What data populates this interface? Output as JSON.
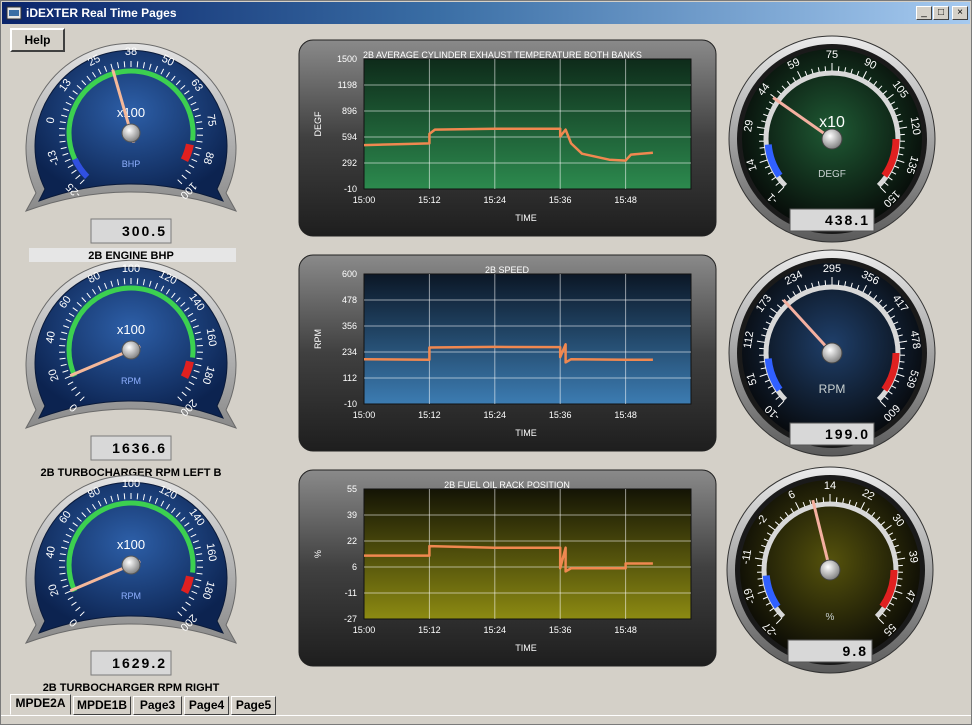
{
  "window": {
    "title": "iDEXTER Real Time Pages"
  },
  "window_controls": {
    "minimize": "_",
    "maximize": "□",
    "close": "×"
  },
  "help": {
    "label": "Help"
  },
  "tabs": [
    {
      "label": "MPDE2A",
      "active": true
    },
    {
      "label": "MPDE1B",
      "active": false
    },
    {
      "label": "Page3",
      "active": false
    },
    {
      "label": "Page4",
      "active": false
    },
    {
      "label": "Page5",
      "active": false
    }
  ],
  "left_gauges": [
    {
      "ticks": [
        "-25",
        "-13",
        "0",
        "13",
        "25",
        "38",
        "50",
        "63",
        "75",
        "88",
        "100"
      ],
      "min": -25,
      "max": 100,
      "value": 30.05,
      "multiplier": "x100",
      "unit": "BHP",
      "readout": "300.5",
      "caption": "2B ENGINE BHP",
      "caption_highlight": true
    },
    {
      "ticks": [
        "0",
        "20",
        "40",
        "60",
        "80",
        "100",
        "120",
        "140",
        "160",
        "180",
        "200"
      ],
      "min": 0,
      "max": 200,
      "value": 16.37,
      "multiplier": "x100",
      "unit": "RPM",
      "readout": "1636.6",
      "caption": "2B TURBOCHARGER RPM LEFT B",
      "caption_highlight": false
    },
    {
      "ticks": [
        "0",
        "20",
        "40",
        "60",
        "80",
        "100",
        "120",
        "140",
        "160",
        "180",
        "200"
      ],
      "min": 0,
      "max": 200,
      "value": 16.29,
      "multiplier": "x100",
      "unit": "RPM",
      "readout": "1629.2",
      "caption": "2B TURBOCHARGER RPM RIGHT",
      "caption_highlight": false
    }
  ],
  "right_gauges": [
    {
      "ticks": [
        "-1",
        "14",
        "29",
        "44",
        "59",
        "75",
        "90",
        "105",
        "120",
        "135",
        "150"
      ],
      "min": -1,
      "max": 150,
      "value": 43.8,
      "multiplier": "x10",
      "unit": "DEGF",
      "readout": "438.1",
      "face_color": "#1f5a34"
    },
    {
      "ticks": [
        "-10",
        "51",
        "112",
        "173",
        "234",
        "295",
        "356",
        "417",
        "478",
        "539",
        "600"
      ],
      "min": -10,
      "max": 600,
      "value": 199.0,
      "multiplier": "",
      "unit": "RPM",
      "readout": "199.0",
      "face_color": "#1f3f6a"
    },
    {
      "ticks": [
        "-27",
        "-19",
        "-11",
        "-2",
        "6",
        "14",
        "22",
        "30",
        "39",
        "47",
        "55"
      ],
      "min": -27,
      "max": 55,
      "value": 9.8,
      "multiplier": "",
      "unit": "%",
      "readout": "9.8",
      "face_color": "#55520c"
    }
  ],
  "chart_data": [
    {
      "type": "line",
      "title": "2B AVERAGE CYLINDER EXHAUST TEMPERATURE BOTH BANKS",
      "xlabel": "TIME",
      "ylabel": "DEGF",
      "x_ticks": [
        "15:00",
        "15:12",
        "15:24",
        "15:36",
        "15:48"
      ],
      "y_ticks": [
        "1500",
        "1198",
        "896",
        "594",
        "292",
        "-10"
      ],
      "ylim": [
        -10,
        1500
      ],
      "xlim": [
        "15:00",
        "16:00"
      ],
      "grid": true,
      "bg_top": "#0e2b1a",
      "bg_bottom": "#2c8a4e",
      "series": [
        {
          "color": "#f08850",
          "x": [
            "15:00",
            "15:06",
            "15:12",
            "15:12",
            "15:13",
            "15:24",
            "15:36",
            "15:36",
            "15:37",
            "15:38",
            "15:40",
            "15:45",
            "15:48",
            "15:49",
            "15:53"
          ],
          "y": [
            500,
            510,
            520,
            630,
            680,
            690,
            690,
            600,
            680,
            520,
            400,
            330,
            320,
            390,
            410
          ]
        }
      ]
    },
    {
      "type": "line",
      "title": "2B SPEED",
      "xlabel": "TIME",
      "ylabel": "RPM",
      "x_ticks": [
        "15:00",
        "15:12",
        "15:24",
        "15:36",
        "15:48"
      ],
      "y_ticks": [
        "600",
        "478",
        "356",
        "234",
        "112",
        "-10"
      ],
      "ylim": [
        -10,
        600
      ],
      "xlim": [
        "15:00",
        "16:00"
      ],
      "grid": true,
      "bg_top": "#0b1726",
      "bg_bottom": "#3c7cb2",
      "series": [
        {
          "color": "#f08850",
          "x": [
            "15:00",
            "15:12",
            "15:12",
            "15:24",
            "15:36",
            "15:36",
            "15:37",
            "15:37",
            "15:38",
            "15:48",
            "15:53"
          ],
          "y": [
            200,
            198,
            255,
            258,
            257,
            210,
            270,
            185,
            200,
            198,
            198
          ]
        }
      ]
    },
    {
      "type": "line",
      "title": "2B FUEL OIL RACK POSITION",
      "xlabel": "TIME",
      "ylabel": "%",
      "x_ticks": [
        "15:00",
        "15:12",
        "15:24",
        "15:36",
        "15:48"
      ],
      "y_ticks": [
        "55",
        "39",
        "22",
        "6",
        "-11",
        "-27"
      ],
      "ylim": [
        -27,
        55
      ],
      "xlim": [
        "15:00",
        "16:00"
      ],
      "grid": true,
      "bg_top": "#141405",
      "bg_bottom": "#8c8a12",
      "series": [
        {
          "color": "#f08850",
          "x": [
            "15:00",
            "15:12",
            "15:12",
            "15:24",
            "15:36",
            "15:36",
            "15:37",
            "15:37",
            "15:38",
            "15:48",
            "15:48",
            "15:53"
          ],
          "y": [
            13,
            13,
            19,
            18,
            18,
            5,
            18,
            3,
            5,
            5,
            8,
            8
          ]
        }
      ]
    }
  ]
}
